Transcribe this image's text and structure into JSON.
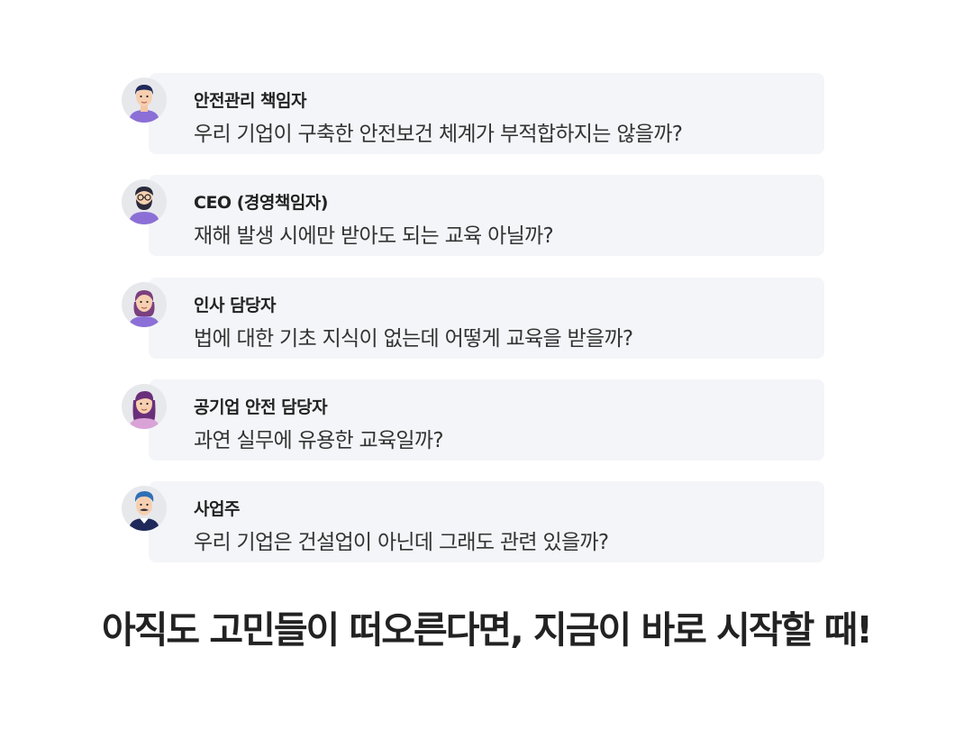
{
  "items": [
    {
      "role": "안전관리 책임자",
      "question": "우리 기업이 구축한 안전보건 체계가 부적합하지는 않을까?",
      "avatar_icon": "man-short-hair-avatar-icon"
    },
    {
      "role": "CEO (경영책임자)",
      "question": "재해 발생 시에만 받아도 되는 교육 아닐까?",
      "avatar_icon": "man-bearded-glasses-avatar-icon"
    },
    {
      "role": "인사 담당자",
      "question": "법에 대한 기초 지식이 없는데 어떻게 교육을 받을까?",
      "avatar_icon": "woman-short-hair-avatar-icon"
    },
    {
      "role": "공기업 안전 담당자",
      "question": "과연 실무에 유용한 교육일까?",
      "avatar_icon": "woman-long-hair-avatar-icon"
    },
    {
      "role": "사업주",
      "question": "우리 기업은 건설업이 아닌데 그래도 관련 있을까?",
      "avatar_icon": "man-mustache-avatar-icon"
    }
  ],
  "headline": "아직도 고민들이 떠오른다면, 지금이 바로 시작할 때!",
  "colors": {
    "card_bg": "#f4f5f8",
    "text_dark": "#222222",
    "shirt_purple": "#8b6fd6",
    "hair_navy": "#1f2a5a"
  }
}
